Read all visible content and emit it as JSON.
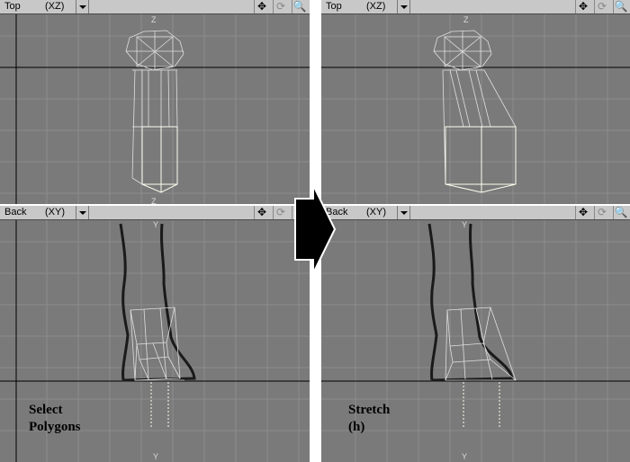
{
  "left": {
    "top_view": {
      "name": "Top",
      "axis": "(XZ)"
    },
    "back_view": {
      "name": "Back",
      "axis": "(XY)"
    },
    "caption_line1": "Select",
    "caption_line2": "Polygons"
  },
  "right": {
    "top_view": {
      "name": "Top",
      "axis": "(XZ)"
    },
    "back_view": {
      "name": "Back",
      "axis": "(XY)"
    },
    "caption_line1": "Stretch",
    "caption_line2": "(h)"
  },
  "axis_labels": {
    "z": "Z",
    "y": "Y"
  },
  "toolbar_icons": [
    "move-view-icon",
    "rotate-view-icon",
    "zoom-view-icon"
  ],
  "colors": {
    "viewport_bg": "#7a7a7a",
    "grid": "#8a8a8a",
    "selected": "#fffff0",
    "wire": "#e8e8e8"
  }
}
